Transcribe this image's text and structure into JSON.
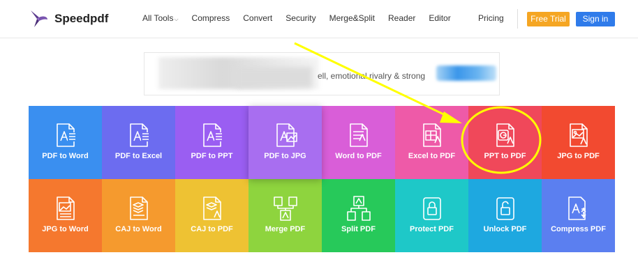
{
  "brand": {
    "name": "Speedpdf",
    "color": "#5b3a8e"
  },
  "nav": [
    {
      "label": "All Tools",
      "has_dropdown": true
    },
    {
      "label": "Compress"
    },
    {
      "label": "Convert"
    },
    {
      "label": "Security"
    },
    {
      "label": "Merge&Split"
    },
    {
      "label": "Reader"
    },
    {
      "label": "Editor"
    }
  ],
  "header": {
    "pricing": "Pricing",
    "free_trial": "Free Trial",
    "sign_in": "Sign in",
    "free_trial_color": "#f5a623",
    "sign_in_color": "#2f7bea"
  },
  "banner": {
    "text": "ell, emotional rivalry & strong"
  },
  "tools": [
    {
      "label": "PDF to Word",
      "color": "#3a8ff0",
      "icon": "pdf-doc-icon"
    },
    {
      "label": "PDF to Excel",
      "color": "#6c6cf0",
      "icon": "pdf-doc-icon"
    },
    {
      "label": "PDF to PPT",
      "color": "#9a5ef2",
      "icon": "pdf-doc-icon"
    },
    {
      "label": "PDF to JPG",
      "color": "#a86ef0",
      "icon": "pdf-image-icon"
    },
    {
      "label": "Word to PDF",
      "color": "#d95ed8",
      "icon": "word-doc-icon"
    },
    {
      "label": "Excel to PDF",
      "color": "#ee5aa8",
      "icon": "excel-grid-icon"
    },
    {
      "label": "PPT to PDF",
      "color": "#f0485a",
      "icon": "ppt-chart-icon"
    },
    {
      "label": "JPG to PDF",
      "color": "#f24a30",
      "icon": "image-pdf-icon"
    },
    {
      "label": "JPG to Word",
      "color": "#f5782e",
      "icon": "image-doc-icon"
    },
    {
      "label": "CAJ to Word",
      "color": "#f59a2e",
      "icon": "caj-layers-icon"
    },
    {
      "label": "CAJ to PDF",
      "color": "#eec233",
      "icon": "caj-pdf-icon"
    },
    {
      "label": "Merge PDF",
      "color": "#8ed43e",
      "icon": "merge-icon"
    },
    {
      "label": "Split PDF",
      "color": "#27c95a",
      "icon": "split-icon"
    },
    {
      "label": "Protect PDF",
      "color": "#1ec8c8",
      "icon": "lock-icon"
    },
    {
      "label": "Unlock PDF",
      "color": "#1ea8e0",
      "icon": "unlock-icon"
    },
    {
      "label": "Compress PDF",
      "color": "#5b7ff0",
      "icon": "compress-icon"
    }
  ],
  "annotation": {
    "color": "#ffff00",
    "highlighted_tool": "PPT to PDF"
  }
}
